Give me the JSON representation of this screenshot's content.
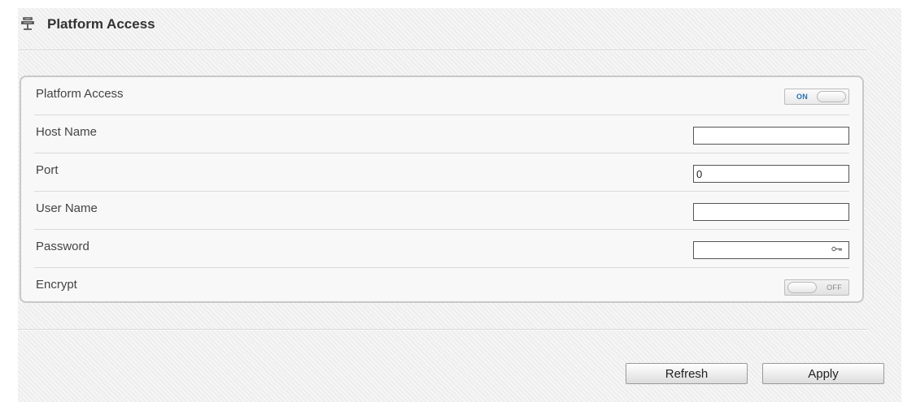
{
  "header": {
    "title": "Platform Access",
    "icon": "server-icon"
  },
  "form": {
    "platform_access": {
      "label": "Platform Access",
      "toggle_state": "ON",
      "enabled": true
    },
    "host_name": {
      "label": "Host Name",
      "value": ""
    },
    "port": {
      "label": "Port",
      "value": "0"
    },
    "user_name": {
      "label": "User Name",
      "value": ""
    },
    "password": {
      "label": "Password",
      "value": "",
      "indicator": "key-icon"
    },
    "encrypt": {
      "label": "Encrypt",
      "toggle_state": "OFF",
      "enabled": false
    }
  },
  "buttons": {
    "refresh": "Refresh",
    "apply": "Apply"
  },
  "colors": {
    "toggle_on_text": "#2b6fb5",
    "toggle_off_text": "#8a8a8a",
    "panel_background": "#f1f1f1"
  }
}
